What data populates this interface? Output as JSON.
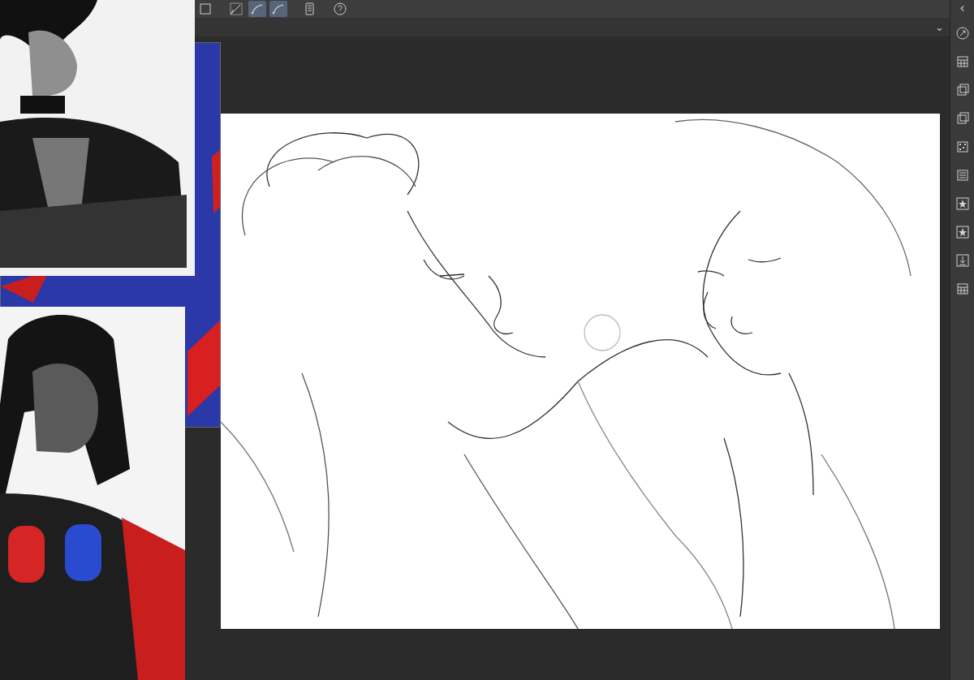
{
  "toolbar": {
    "tools": [
      {
        "kind": "checkbox",
        "selected": false
      },
      {
        "kind": "pen",
        "selected": false
      },
      {
        "kind": "curve",
        "selected": true
      },
      {
        "kind": "curve",
        "selected": true
      },
      {
        "kind": "phone",
        "selected": false
      },
      {
        "kind": "help",
        "selected": false
      }
    ]
  },
  "collapse_button": "‹",
  "dropdown_button": "⌄",
  "side_palette": {
    "icons": [
      {
        "kind": "navigator"
      },
      {
        "kind": "grid"
      },
      {
        "kind": "layers"
      },
      {
        "kind": "layers"
      },
      {
        "kind": "pattern"
      },
      {
        "kind": "list"
      },
      {
        "kind": "star"
      },
      {
        "kind": "star"
      },
      {
        "kind": "download"
      },
      {
        "kind": "grid"
      }
    ]
  }
}
